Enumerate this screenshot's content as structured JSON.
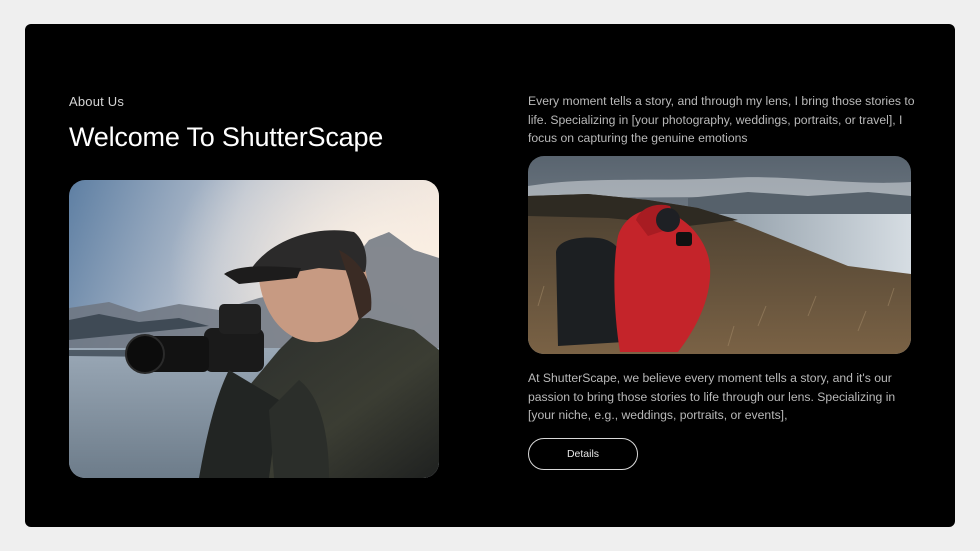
{
  "section": {
    "eyebrow": "About Us",
    "title": "Welcome To ShutterScape"
  },
  "intro": {
    "text": "Every moment tells a story, and through my lens, I bring those stories to life. Specializing in [your photography, weddings, portraits, or travel], I focus on capturing the genuine emotions"
  },
  "body": {
    "text": "At ShutterScape, we believe every moment tells a story, and it's our passion to bring those stories to life through our lens. Specializing in [your niche, e.g., weddings, portraits, or events],"
  },
  "actions": {
    "details_label": "Details"
  },
  "colors": {
    "page_background": "#efefef",
    "card_background": "#000000",
    "title": "#ffffff",
    "body_text": "#b9b9b9",
    "button_border": "#d8d8d8"
  }
}
